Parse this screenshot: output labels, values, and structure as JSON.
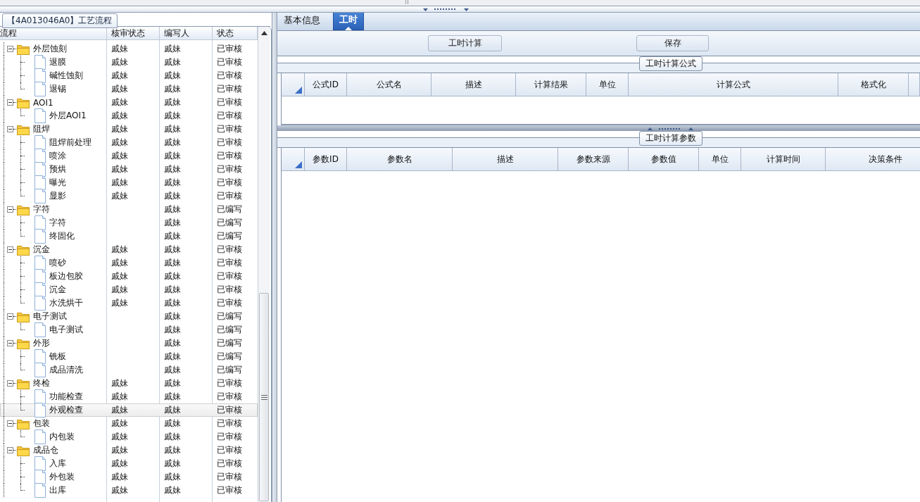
{
  "left_panel": {
    "title": "【4A013046A0】工艺流程",
    "columns": [
      "流程",
      "核审状态",
      "编写人",
      "状态"
    ],
    "tree": [
      {
        "label": "外层蚀刻",
        "reviewer": "戚妹",
        "writer": "戚妹",
        "status": "已审核",
        "expanded": true,
        "selected": false,
        "children": [
          {
            "label": "退膜",
            "reviewer": "戚妹",
            "writer": "戚妹",
            "status": "已审核",
            "selected": false
          },
          {
            "label": "碱性蚀刻",
            "reviewer": "戚妹",
            "writer": "戚妹",
            "status": "已审核",
            "selected": false
          },
          {
            "label": "退锡",
            "reviewer": "戚妹",
            "writer": "戚妹",
            "status": "已审核",
            "selected": false
          }
        ]
      },
      {
        "label": "AOI1",
        "reviewer": "戚妹",
        "writer": "戚妹",
        "status": "已审核",
        "expanded": true,
        "selected": false,
        "children": [
          {
            "label": "外层AOI1",
            "reviewer": "戚妹",
            "writer": "戚妹",
            "status": "已审核",
            "selected": false
          }
        ]
      },
      {
        "label": "阻焊",
        "reviewer": "戚妹",
        "writer": "戚妹",
        "status": "已审核",
        "expanded": true,
        "selected": false,
        "children": [
          {
            "label": "阻焊前处理",
            "reviewer": "戚妹",
            "writer": "戚妹",
            "status": "已审核",
            "selected": false
          },
          {
            "label": "喷涂",
            "reviewer": "戚妹",
            "writer": "戚妹",
            "status": "已审核",
            "selected": false
          },
          {
            "label": "预烘",
            "reviewer": "戚妹",
            "writer": "戚妹",
            "status": "已审核",
            "selected": false
          },
          {
            "label": "曝光",
            "reviewer": "戚妹",
            "writer": "戚妹",
            "status": "已审核",
            "selected": false
          },
          {
            "label": "显影",
            "reviewer": "戚妹",
            "writer": "戚妹",
            "status": "已审核",
            "selected": false
          }
        ]
      },
      {
        "label": "字符",
        "writer": "戚妹",
        "status": "已编写",
        "expanded": true,
        "selected": false,
        "children": [
          {
            "label": "字符",
            "writer": "戚妹",
            "status": "已编写",
            "selected": false
          },
          {
            "label": "终固化",
            "writer": "戚妹",
            "status": "已编写",
            "selected": false
          }
        ]
      },
      {
        "label": "沉金",
        "reviewer": "戚妹",
        "writer": "戚妹",
        "status": "已审核",
        "expanded": true,
        "selected": false,
        "children": [
          {
            "label": "喷砂",
            "reviewer": "戚妹",
            "writer": "戚妹",
            "status": "已审核",
            "selected": false
          },
          {
            "label": "板边包胶",
            "reviewer": "戚妹",
            "writer": "戚妹",
            "status": "已审核",
            "selected": false
          },
          {
            "label": "沉金",
            "reviewer": "戚妹",
            "writer": "戚妹",
            "status": "已审核",
            "selected": false
          },
          {
            "label": "水洗烘干",
            "reviewer": "戚妹",
            "writer": "戚妹",
            "status": "已审核",
            "selected": false
          }
        ]
      },
      {
        "label": "电子测试",
        "writer": "戚妹",
        "status": "已编写",
        "expanded": true,
        "selected": false,
        "children": [
          {
            "label": "电子测试",
            "writer": "戚妹",
            "status": "已编写",
            "selected": false
          }
        ]
      },
      {
        "label": "外形",
        "writer": "戚妹",
        "status": "已编写",
        "expanded": true,
        "selected": false,
        "children": [
          {
            "label": "铣板",
            "writer": "戚妹",
            "status": "已编写",
            "selected": false
          },
          {
            "label": "成品清洗",
            "writer": "戚妹",
            "status": "已编写",
            "selected": false
          }
        ]
      },
      {
        "label": "终检",
        "reviewer": "戚妹",
        "writer": "戚妹",
        "status": "已审核",
        "expanded": true,
        "selected": false,
        "children": [
          {
            "label": "功能检查",
            "reviewer": "戚妹",
            "writer": "戚妹",
            "status": "已审核",
            "selected": false
          },
          {
            "label": "外观检查",
            "reviewer": "戚妹",
            "writer": "戚妹",
            "status": "已审核",
            "selected": true
          }
        ]
      },
      {
        "label": "包装",
        "reviewer": "戚妹",
        "writer": "戚妹",
        "status": "已审核",
        "expanded": true,
        "selected": false,
        "children": [
          {
            "label": "内包装",
            "reviewer": "戚妹",
            "writer": "戚妹",
            "status": "已审核",
            "selected": false
          }
        ]
      },
      {
        "label": "成品仓",
        "reviewer": "戚妹",
        "writer": "戚妹",
        "status": "已审核",
        "expanded": true,
        "selected": false,
        "children": [
          {
            "label": "入库",
            "reviewer": "戚妹",
            "writer": "戚妹",
            "status": "已审核",
            "selected": false
          },
          {
            "label": "外包装",
            "reviewer": "戚妹",
            "writer": "戚妹",
            "status": "已审核",
            "selected": false
          },
          {
            "label": "出库",
            "reviewer": "戚妹",
            "writer": "戚妹",
            "status": "已审核",
            "selected": false
          }
        ]
      }
    ]
  },
  "tabs": [
    {
      "label": "基本信息",
      "selected": false
    },
    {
      "label": "工时",
      "selected": true
    }
  ],
  "toolbar": {
    "buttons": [
      "工时计算",
      "保存"
    ]
  },
  "formula_group": {
    "title": "工时计算公式",
    "columns": [
      "公式ID",
      "公式名",
      "描述",
      "计算结果",
      "单位",
      "计算公式",
      "格式化"
    ]
  },
  "param_group": {
    "title": "工时计算参数",
    "columns": [
      "参数ID",
      "参数名",
      "描述",
      "参数来源",
      "参数值",
      "单位",
      "计算时间",
      "决策条件"
    ]
  }
}
